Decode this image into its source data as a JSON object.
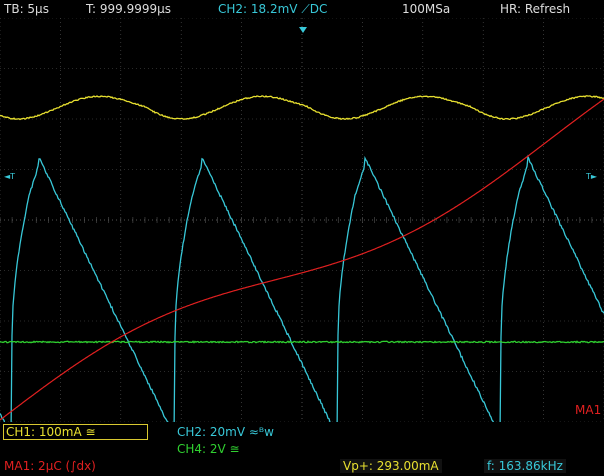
{
  "topbar": {
    "timebase": "TB: 5µs",
    "trigger_time": "T: 999.9999µs",
    "trigger_setting": "CH2: 18.2mV ⟋DC",
    "sample_rate": "100MSa",
    "mode": "HR: Refresh"
  },
  "markers": {
    "trigger_left": "◄T",
    "trigger_right": "T►",
    "math_label": "MA1"
  },
  "channels": {
    "ch1": "CH1: 100mA ≅",
    "ch2": "CH2: 20mV ≈ᴮw",
    "ch4": "CH4: 2V ≅",
    "ma1": "MA1: 2µC (∫dx)"
  },
  "measurements": {
    "vp": "Vp+: 293.00mA",
    "freq": "f: 163.86kHz"
  },
  "colors": {
    "ch1": "#e8e030",
    "ch2": "#38c8d8",
    "ch4": "#30d030",
    "ma1": "#e02020",
    "grid": "#555555"
  }
}
